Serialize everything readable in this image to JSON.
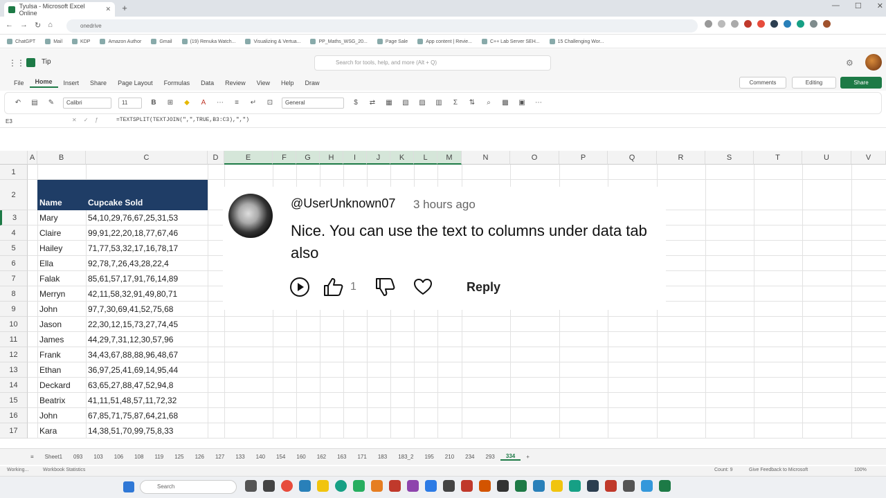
{
  "browser": {
    "tab_title": "Tyulsa - Microsoft Excel Online",
    "new_tab": "+",
    "url": "onedrive"
  },
  "bookmarks": [
    "ChatGPT",
    "Mail",
    "KDP",
    "Amazon Author",
    "Gmail",
    "(19) Renuka Watch...",
    "Visualizing & Vertua...",
    "PP_Maths_WSG_20...",
    "Page Sale",
    "App content | Revie...",
    "C++ Lab Server SEH...",
    "15 Challenging Wor..."
  ],
  "excel": {
    "doc_name": "Tip",
    "search_placeholder": "Search for tools, help, and more (Alt + Q)",
    "menu": [
      "File",
      "Home",
      "Insert",
      "Share",
      "Page Layout",
      "Formulas",
      "Data",
      "Review",
      "View",
      "Help",
      "Draw"
    ],
    "comments_label": "Comments",
    "editing_label": "Editing",
    "share_label": "Share",
    "font_name": "Calibri",
    "font_size": "11",
    "number_format": "General",
    "name_box": "E3",
    "formula": "=TEXTSPLIT(TEXTJOIN(\",\",TRUE,B3:C3),\",\")"
  },
  "grid": {
    "columns": [
      "A",
      "B",
      "C",
      "D",
      "E",
      "F",
      "G",
      "H",
      "I",
      "J",
      "K",
      "L",
      "M",
      "N",
      "O",
      "P",
      "Q",
      "R",
      "S",
      "T",
      "U",
      "V"
    ],
    "rows": [
      "1",
      "2",
      "3",
      "4",
      "5",
      "6",
      "7",
      "8",
      "9",
      "10",
      "11",
      "12",
      "13",
      "14",
      "15",
      "16",
      "17"
    ],
    "header_name": "Name",
    "header_sold": "Cupcake Sold",
    "data": [
      {
        "name": "Mary",
        "sold": "54,10,29,76,67,25,31,53"
      },
      {
        "name": "Claire",
        "sold": "99,91,22,20,18,77,67,46"
      },
      {
        "name": "Hailey",
        "sold": "71,77,53,32,17,16,78,17"
      },
      {
        "name": "Ella",
        "sold": "92,78,7,26,43,28,22,4"
      },
      {
        "name": "Falak",
        "sold": "85,61,57,17,91,76,14,89"
      },
      {
        "name": "Merryn",
        "sold": "42,11,58,32,91,49,80,71"
      },
      {
        "name": "John",
        "sold": "97,7,30,69,41,52,75,68"
      },
      {
        "name": "Jason",
        "sold": "22,30,12,15,73,27,74,45"
      },
      {
        "name": "James",
        "sold": "44,29,7,31,12,30,57,96"
      },
      {
        "name": "Frank",
        "sold": "34,43,67,88,88,96,48,67"
      },
      {
        "name": "Ethan",
        "sold": "36,97,25,41,69,14,95,44"
      },
      {
        "name": "Deckard",
        "sold": "63,65,27,88,47,52,94,8"
      },
      {
        "name": "Beatrix",
        "sold": "41,11,51,48,57,11,72,32"
      },
      {
        "name": "John",
        "sold": "67,85,71,75,87,64,21,68"
      },
      {
        "name": "Kara",
        "sold": "14,38,51,70,99,75,8,33"
      }
    ]
  },
  "comment": {
    "username": "@UserUnknown07",
    "time": "3 hours ago",
    "text": "Nice. You can use the text to columns under data tab also",
    "like_count": "1",
    "reply_label": "Reply"
  },
  "sheet_tabs": [
    "Sheet1",
    "093",
    "103",
    "106",
    "108",
    "119",
    "125",
    "126",
    "127",
    "133",
    "140",
    "154",
    "160",
    "162",
    "163",
    "171",
    "183",
    "183_2",
    "195",
    "210",
    "234",
    "293",
    "334"
  ],
  "active_sheet": "334",
  "add_sheet": "+",
  "status": {
    "left": "Working...",
    "stats": "Workbook Statistics",
    "count": "Count: 9",
    "feedback": "Give Feedback to Microsoft",
    "zoom": "100%"
  },
  "taskbar": {
    "search_placeholder": "Search"
  }
}
